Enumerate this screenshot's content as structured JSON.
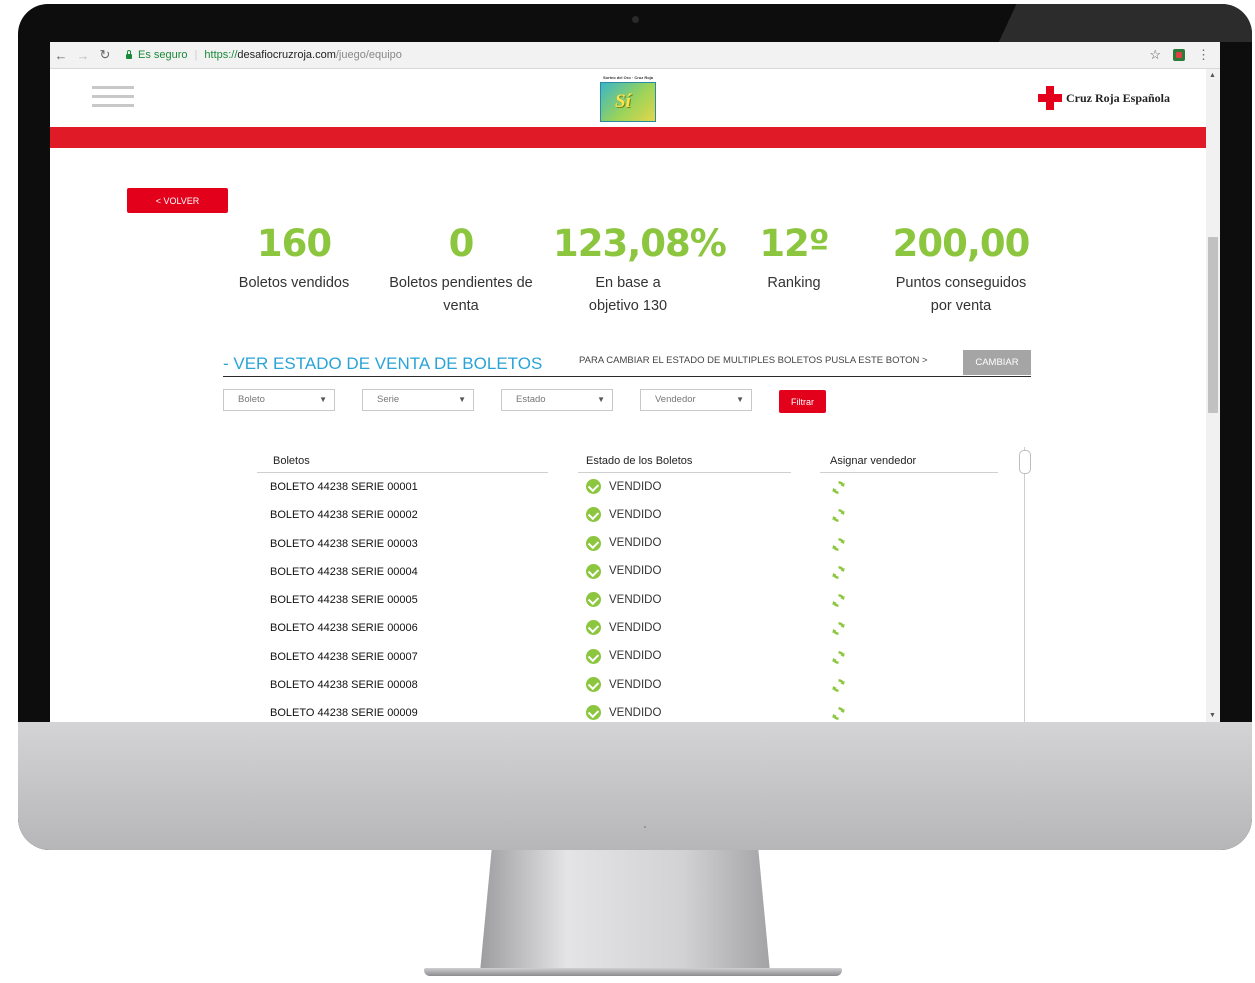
{
  "browser": {
    "secure_label": "Es seguro",
    "url_protocol": "https://",
    "url_host": "desafiocruzroja.com",
    "url_path": "/juego/equipo"
  },
  "header": {
    "logo_top_text": "Sorteo del Oro · Cruz Roja",
    "logo_card_text": "Sí",
    "brand_text": "Cruz Roja Española",
    "brand_color": "#e3001b"
  },
  "actions": {
    "volver_label": "< VOLVER",
    "cambiar_prompt": "PARA CAMBIAR EL ESTADO DE MULTIPLES BOLETOS PUSLA ESTE BOTON >",
    "cambiar_label": "CAMBIAR",
    "filtrar_label": "Filtrar"
  },
  "stats": [
    {
      "value": "160",
      "label": "Boletos vendidos"
    },
    {
      "value": "0",
      "label": "Boletos pendientes de venta"
    },
    {
      "value": "123,08%",
      "label": "En base a objetivo 130"
    },
    {
      "value": "12º",
      "label": "Ranking"
    },
    {
      "value": "200,00",
      "label": "Puntos conseguidos por venta"
    }
  ],
  "section_title": "-  VER ESTADO DE VENTA DE BOLETOS",
  "filters": [
    {
      "value": "Boleto"
    },
    {
      "value": "Serie"
    },
    {
      "value": "Estado"
    },
    {
      "value": "Vendedor"
    }
  ],
  "table": {
    "headers": [
      "Boletos",
      "Estado de los Boletos",
      "Asignar vendedor"
    ],
    "rows": [
      {
        "boleto": "BOLETO 44238 SERIE 00001",
        "estado": "VENDIDO"
      },
      {
        "boleto": "BOLETO 44238 SERIE 00002",
        "estado": "VENDIDO"
      },
      {
        "boleto": "BOLETO 44238 SERIE 00003",
        "estado": "VENDIDO"
      },
      {
        "boleto": "BOLETO 44238 SERIE 00004",
        "estado": "VENDIDO"
      },
      {
        "boleto": "BOLETO 44238 SERIE 00005",
        "estado": "VENDIDO"
      },
      {
        "boleto": "BOLETO 44238 SERIE 00006",
        "estado": "VENDIDO"
      },
      {
        "boleto": "BOLETO 44238 SERIE 00007",
        "estado": "VENDIDO"
      },
      {
        "boleto": "BOLETO 44238 SERIE 00008",
        "estado": "VENDIDO"
      },
      {
        "boleto": "BOLETO 44238 SERIE 00009",
        "estado": "VENDIDO"
      }
    ]
  },
  "colors": {
    "accent_green": "#8cc63f",
    "brand_red": "#e3001b",
    "link_blue": "#2aa3d8"
  },
  "icons": {
    "status": "check-circle-icon",
    "assign": "refresh-icon"
  }
}
